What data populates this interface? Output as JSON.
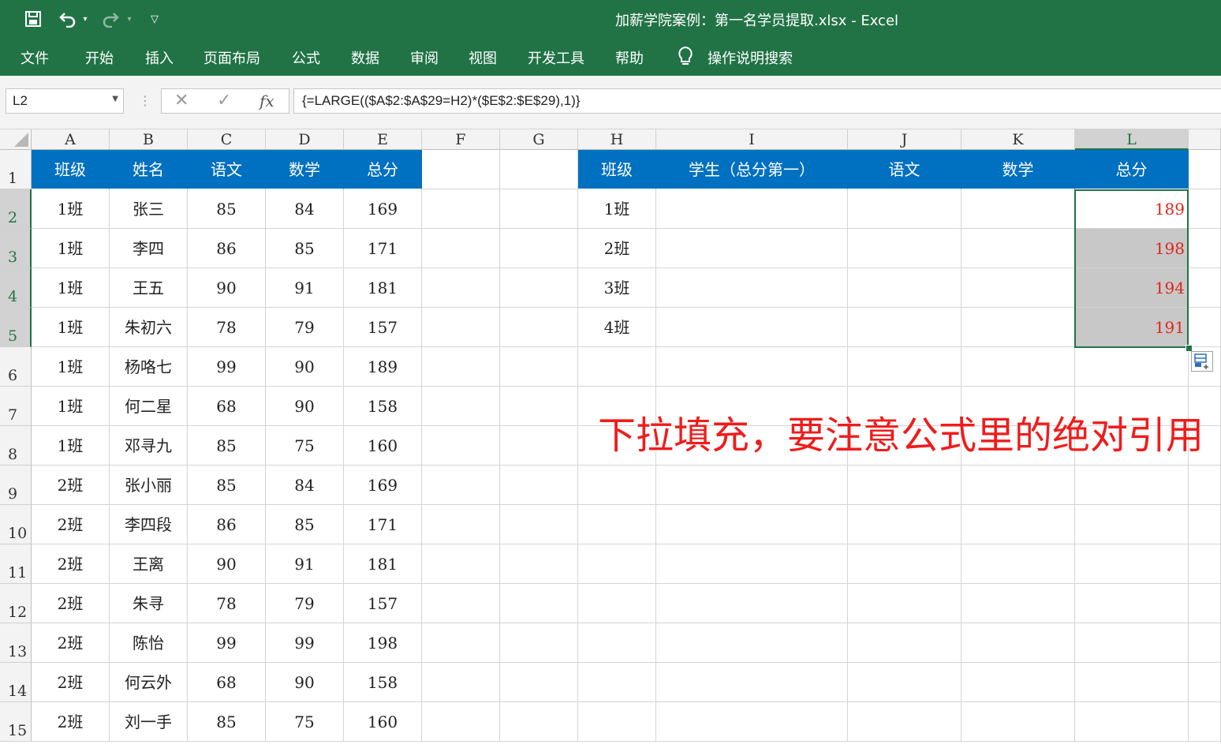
{
  "window": {
    "title": "加薪学院案例：第一名学员提取.xlsx  -  Excel"
  },
  "ribbon": {
    "tabs": [
      "文件",
      "开始",
      "插入",
      "页面布局",
      "公式",
      "数据",
      "审阅",
      "视图",
      "开发工具",
      "帮助"
    ],
    "search_label": "操作说明搜索"
  },
  "formula_bar": {
    "name_box": "L2",
    "fx": "fx",
    "formula": "{=LARGE(($A$2:$A$29=H2)*($E$2:$E$29),1)}"
  },
  "columns": [
    "A",
    "B",
    "C",
    "D",
    "E",
    "F",
    "G",
    "H",
    "I",
    "J",
    "K",
    "L"
  ],
  "selected_column": "L",
  "rows": [
    "1",
    "2",
    "3",
    "4",
    "5",
    "6",
    "7",
    "8",
    "9",
    "10",
    "11",
    "12",
    "13",
    "14",
    "15"
  ],
  "left_table": {
    "headers": [
      "班级",
      "姓名",
      "语文",
      "数学",
      "总分"
    ],
    "rows": [
      [
        "1班",
        "张三",
        "85",
        "84",
        "169"
      ],
      [
        "1班",
        "李四",
        "86",
        "85",
        "171"
      ],
      [
        "1班",
        "王五",
        "90",
        "91",
        "181"
      ],
      [
        "1班",
        "朱初六",
        "78",
        "79",
        "157"
      ],
      [
        "1班",
        "杨咯七",
        "99",
        "90",
        "189"
      ],
      [
        "1班",
        "何二星",
        "68",
        "90",
        "158"
      ],
      [
        "1班",
        "邓寻九",
        "85",
        "75",
        "160"
      ],
      [
        "2班",
        "张小丽",
        "85",
        "84",
        "169"
      ],
      [
        "2班",
        "李四段",
        "86",
        "85",
        "171"
      ],
      [
        "2班",
        "王离",
        "90",
        "91",
        "181"
      ],
      [
        "2班",
        "朱寻",
        "78",
        "79",
        "157"
      ],
      [
        "2班",
        "陈怡",
        "99",
        "99",
        "198"
      ],
      [
        "2班",
        "何云外",
        "68",
        "90",
        "158"
      ],
      [
        "2班",
        "刘一手",
        "85",
        "75",
        "160"
      ]
    ]
  },
  "right_table": {
    "headers": [
      "班级",
      "学生（总分第一）",
      "语文",
      "数学",
      "总分"
    ],
    "rows": [
      [
        "1班",
        "",
        "",
        "",
        "189"
      ],
      [
        "2班",
        "",
        "",
        "",
        "198"
      ],
      [
        "3班",
        "",
        "",
        "",
        "194"
      ],
      [
        "4班",
        "",
        "",
        "",
        "191"
      ]
    ]
  },
  "annotation": "下拉填充，要注意公式里的绝对引用",
  "colors": {
    "excel_green": "#217346",
    "header_blue": "#0070c0",
    "result_red": "#e0261c",
    "annotation_red": "#f01c1c"
  }
}
